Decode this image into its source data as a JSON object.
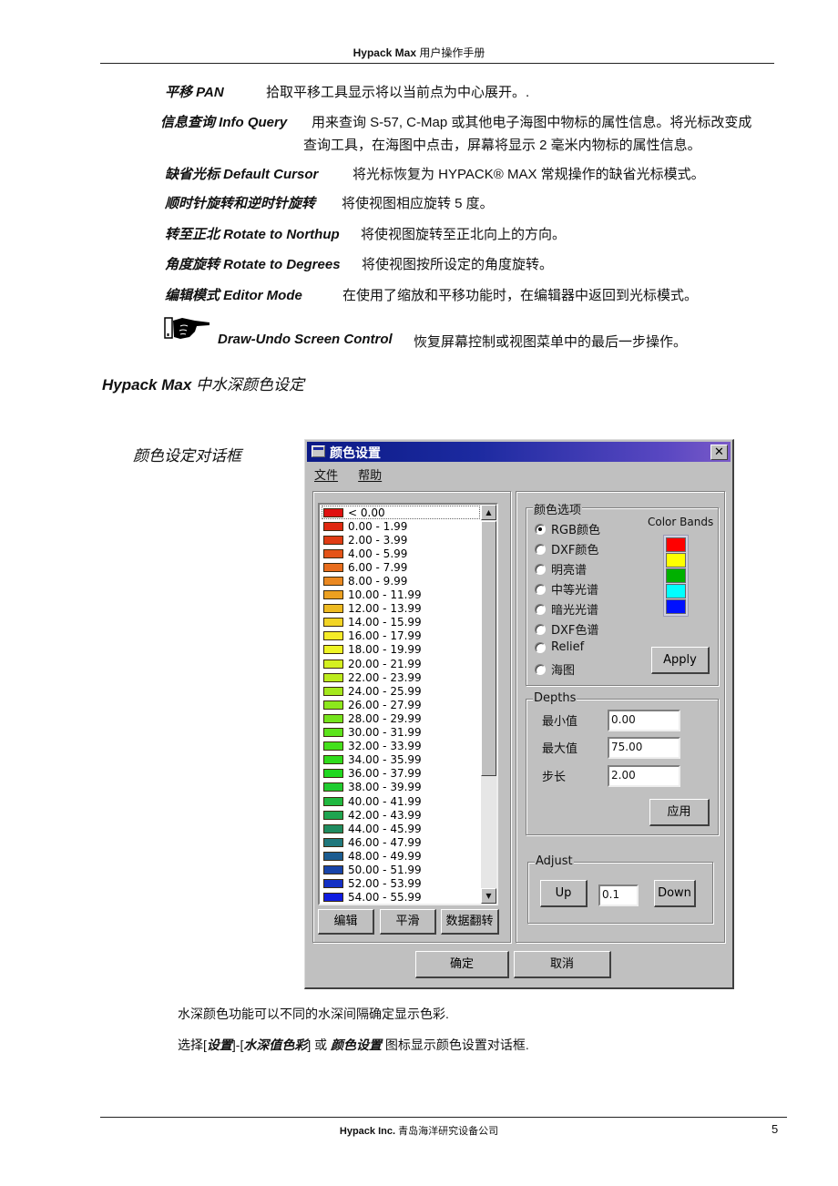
{
  "header": {
    "brand": "Hypack Max",
    "title": "用户操作手册"
  },
  "definitions": [
    {
      "term": "平移 PAN",
      "desc": "拾取平移工具显示将以当前点为中心展开。."
    },
    {
      "term": "信息查询 Info Query",
      "desc": "用来查询  S-57, C-Map 或其他电子海图中物标的属性信息。将光标改变成",
      "desc2": "查询工具，在海图中点击，屏幕将显示 2 毫米内物标的属性信息。"
    },
    {
      "term": "缺省光标 Default Cursor",
      "desc": "将光标恢复为  HYPACK® MAX  常规操作的缺省光标模式。"
    },
    {
      "term": "顺时针旋转和逆时针旋转",
      "desc": "将使视图相应旋转  5  度。"
    },
    {
      "term": "转至正北 Rotate to Northup",
      "desc": "将使视图旋转至正北向上的方向。"
    },
    {
      "term": "角度旋转 Rotate to Degrees",
      "desc": "将使视图按所设定的角度旋转。"
    },
    {
      "term": "编辑模式 Editor Mode",
      "desc": "在使用了缩放和平移功能时，在编辑器中返回到光标模式。"
    }
  ],
  "note": {
    "icon": "pointing-hand-icon",
    "term": "Draw-Undo Screen Control",
    "desc": "恢复屏幕控制或视图菜单中的最后一步操作。"
  },
  "section": {
    "brand": "Hypack Max",
    "title": "中水深颜色设定"
  },
  "caption": "颜色设定对话框",
  "dialog": {
    "title": "颜色设置",
    "close": "✕",
    "menu": [
      "文件",
      "帮助"
    ],
    "depth_list": [
      {
        "label": "< 0.00",
        "color": "#e01010"
      },
      {
        "label": "0.00 - 1.99",
        "color": "#e02810"
      },
      {
        "label": "2.00 - 3.99",
        "color": "#e03c14"
      },
      {
        "label": "4.00 - 5.99",
        "color": "#e45418"
      },
      {
        "label": "6.00 - 7.99",
        "color": "#e86c1c"
      },
      {
        "label": "8.00 - 9.99",
        "color": "#ea8820"
      },
      {
        "label": "10.00 - 11.99",
        "color": "#eca020"
      },
      {
        "label": "12.00 - 13.99",
        "color": "#eeba20"
      },
      {
        "label": "14.00 - 15.99",
        "color": "#f2d424"
      },
      {
        "label": "16.00 - 17.99",
        "color": "#f6ec28"
      },
      {
        "label": "18.00 - 19.99",
        "color": "#eef424"
      },
      {
        "label": "20.00 - 21.99",
        "color": "#d4f020"
      },
      {
        "label": "22.00 - 23.99",
        "color": "#bcec1c"
      },
      {
        "label": "24.00 - 25.99",
        "color": "#a4e81c"
      },
      {
        "label": "26.00 - 27.99",
        "color": "#8ce81c"
      },
      {
        "label": "28.00 - 29.99",
        "color": "#74e41c"
      },
      {
        "label": "30.00 - 31.99",
        "color": "#5ce41c"
      },
      {
        "label": "32.00 - 33.99",
        "color": "#44e01c"
      },
      {
        "label": "34.00 - 35.99",
        "color": "#30dc1c"
      },
      {
        "label": "36.00 - 37.99",
        "color": "#20d820"
      },
      {
        "label": "38.00 - 39.99",
        "color": "#20cc30"
      },
      {
        "label": "40.00 - 41.99",
        "color": "#20b840"
      },
      {
        "label": "42.00 - 43.99",
        "color": "#20a450"
      },
      {
        "label": "44.00 - 45.99",
        "color": "#208c60"
      },
      {
        "label": "46.00 - 47.99",
        "color": "#20787c"
      },
      {
        "label": "48.00 - 49.99",
        "color": "#1c5c90"
      },
      {
        "label": "50.00 - 51.99",
        "color": "#1844a8"
      },
      {
        "label": "52.00 - 53.99",
        "color": "#1430c4"
      },
      {
        "label": "54.00 - 55.99",
        "color": "#101ce0"
      }
    ],
    "list_buttons": [
      "编辑",
      "平滑",
      "数据翻转"
    ],
    "color_options": {
      "legend": "颜色选项",
      "options": [
        "RGB颜色",
        "DXF颜色",
        "明亮谱",
        "中等光谱",
        "暗光光谱",
        "DXF色谱",
        "Relief",
        "海图"
      ],
      "selected": "RGB颜色",
      "bands_label": "Color Bands",
      "bands": [
        "#ff0000",
        "#ffff00",
        "#00b000",
        "#00ffff",
        "#0010ff"
      ],
      "apply": "Apply"
    },
    "depths": {
      "legend": "Depths",
      "fields": [
        {
          "label": "最小值",
          "value": "0.00"
        },
        {
          "label": "最大值",
          "value": "75.00"
        },
        {
          "label": "步长",
          "value": "2.00"
        }
      ],
      "apply": "应用"
    },
    "adjust": {
      "legend": "Adjust",
      "up": "Up",
      "value": "0.1",
      "down": "Down"
    },
    "ok": "确定",
    "cancel": "取消"
  },
  "paragraphs": {
    "p1": "水深颜色功能可以不同的水深间隔确定显示色彩.",
    "p2_pre": "选择[",
    "p2_menu1": "设置",
    "p2_mid": "]-[",
    "p2_menu2": "水深值色彩",
    "p2_mid2": "]  或  ",
    "p2_icon": "颜色设置",
    "p2_post": "  图标显示颜色设置对话框."
  },
  "footer": {
    "brand": "Hypack Inc.",
    "company": "青岛海洋研究设备公司",
    "page": "5"
  }
}
